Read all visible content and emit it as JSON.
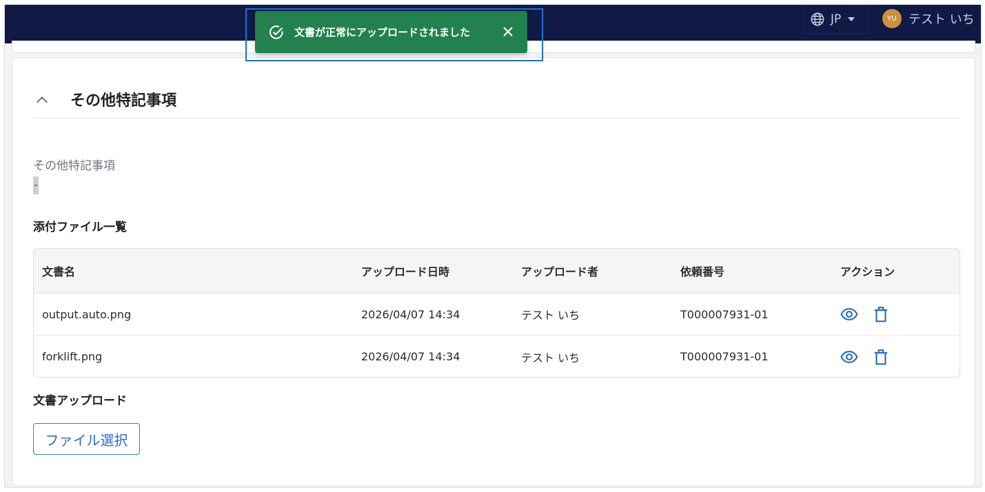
{
  "header": {
    "language_label": "JP",
    "user_initials": "YU",
    "user_name": "テスト いち"
  },
  "toast": {
    "message": "文書が正常にアップロードされました",
    "color": "#23804f"
  },
  "section": {
    "title": "その他特記事項",
    "field_label": "その他特記事項",
    "field_value": "-"
  },
  "attachments": {
    "title": "添付ファイル一覧",
    "columns": [
      "文書名",
      "アップロード日時",
      "アップロード者",
      "依頼番号",
      "アクション"
    ],
    "rows": [
      {
        "name": "output.auto.png",
        "uploaded_at": "2026/04/07 14:34",
        "uploader": "テスト いち",
        "request_no": "T000007931-01"
      },
      {
        "name": "forklift.png",
        "uploaded_at": "2026/04/07 14:34",
        "uploader": "テスト いち",
        "request_no": "T000007931-01"
      }
    ]
  },
  "upload": {
    "title": "文書アップロード",
    "button_label": "ファイル選択"
  },
  "icons": {
    "language": "globe-icon",
    "view": "eye-icon",
    "delete": "trash-icon",
    "collapse": "chevron-up-icon",
    "success": "check-circle-icon",
    "close": "close-icon"
  },
  "colors": {
    "topbar": "#101a45",
    "accent": "#2d6cc0",
    "toast_success": "#23804f"
  }
}
